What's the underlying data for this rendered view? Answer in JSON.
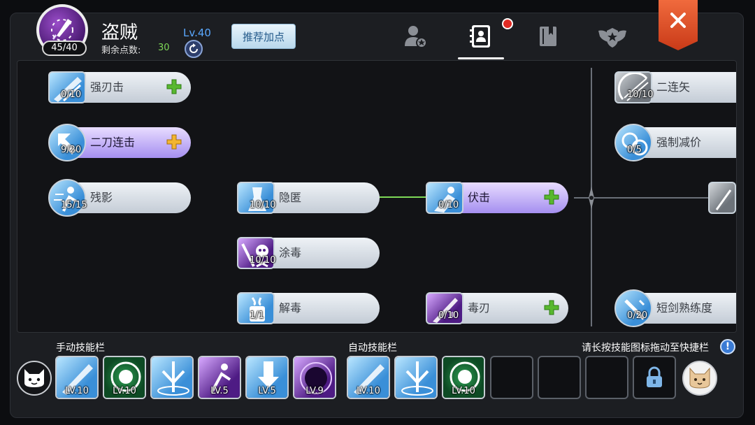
{
  "header": {
    "avatar_count": "45/40",
    "class_name": "盗贼",
    "level": "Lv.40",
    "remaining_points_label": "剩余点数:",
    "remaining_points_value": "30",
    "recommend_button": "推荐加点"
  },
  "tabs": [
    {
      "icon": "character-star-icon"
    },
    {
      "icon": "skill-book-icon",
      "active": true,
      "notification": true
    },
    {
      "icon": "bookmark-book-icon"
    },
    {
      "icon": "wings-emblem-icon"
    }
  ],
  "skills": [
    {
      "name": "强刃击",
      "level": "0/10",
      "plus": "green"
    },
    {
      "name": "二刀连击",
      "level": "9/20",
      "plus": "gold",
      "active": true
    },
    {
      "name": "残影",
      "level": "15/15"
    },
    {
      "name": "隐匿",
      "level": "10/10"
    },
    {
      "name": "涂毒",
      "level": "10/10"
    },
    {
      "name": "解毒",
      "level": "1/1"
    },
    {
      "name": "伏击",
      "level": "0/10",
      "plus": "green",
      "active": true
    },
    {
      "name": "毒刃",
      "level": "0/10",
      "plus": "green"
    },
    {
      "name": "二连矢",
      "level": "10/10"
    },
    {
      "name": "强制减价",
      "level": "0/5"
    },
    {
      "name": "短剑熟练度",
      "level": "0/20"
    }
  ],
  "bottom": {
    "manual_label": "手动技能栏",
    "auto_label": "自动技能栏",
    "hint": "请长按技能图标拖动至快捷栏",
    "manual_slots": [
      {
        "level": "LV.10"
      },
      {
        "level": "LV.10"
      },
      {
        "level": ""
      },
      {
        "level": "LV.5"
      },
      {
        "level": "LV.5"
      },
      {
        "level": "LV.9"
      }
    ],
    "auto_slots": [
      {
        "level": "LV.10"
      },
      {
        "level": ""
      },
      {
        "level": "LV.10"
      }
    ]
  },
  "colors": {
    "accent_blue": "#5aa8ff",
    "points_green": "#7ed957",
    "close_orange": "#e4532a",
    "notify_red": "#e02b24"
  }
}
